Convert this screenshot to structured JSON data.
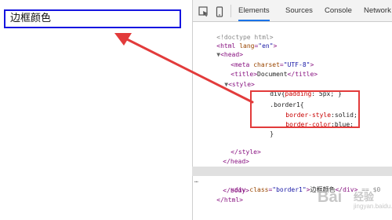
{
  "page": {
    "box_text": "边框颜色",
    "box_border_color": "#1515e0"
  },
  "devtools": {
    "tabs": [
      "Elements",
      "Sources",
      "Console",
      "Network"
    ],
    "active_tab": "Elements",
    "toolbar_icons": [
      "inspect-cursor-icon",
      "device-toggle-icon"
    ],
    "code": {
      "doctype": "<!doctype html>",
      "html_open_tag": "html",
      "html_lang_attr": "lang",
      "html_lang_val": "\"en\"",
      "head_tag": "head",
      "meta_tag": "meta",
      "meta_attr": "charset",
      "meta_val": "\"UTF-8\"",
      "title_tag": "title",
      "title_text": "Document",
      "style_tag": "style",
      "css_rule1_sel": "div",
      "css_rule1_prop": "padding",
      "css_rule1_val": "5px",
      "css_rule2_sel": ".border1{",
      "css_rule2_prop1": "border-style",
      "css_rule2_val1": "solid",
      "css_rule2_prop2": "border-color",
      "css_rule2_val2": "blue",
      "css_rule2_close": "}",
      "body_tag": "body",
      "div_tag": "div",
      "div_attr": "class",
      "div_val": "\"border1\"",
      "div_text": "边框颜色",
      "selected_suffix": "== $0"
    },
    "highlight_color": "#e23b3b"
  },
  "watermark": {
    "logo": "Bai",
    "text": "经验",
    "sub": "jingyan.baidu.com"
  }
}
